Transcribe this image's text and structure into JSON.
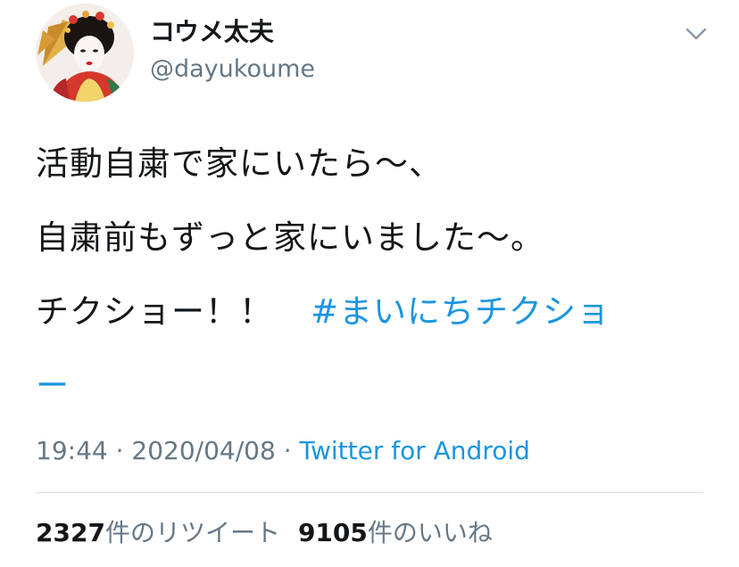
{
  "user": {
    "display_name": "コウメ太夫",
    "handle": "@dayukoume"
  },
  "icons": {
    "avatar": "profile-photo",
    "menu": "chevron-down-icon"
  },
  "tweet": {
    "line1": "活動自粛で家にいたら〜、",
    "line2": "自粛前もずっと家にいました〜。",
    "line3_text": "チクショー！！",
    "hashtag": "#まいにちチクショ",
    "hashtag_wrap": "ー"
  },
  "meta": {
    "time": "19:44",
    "separator1": " · ",
    "date": "2020/04/08",
    "separator2": " · ",
    "source": "Twitter for Android"
  },
  "stats": {
    "retweets_count": "2327",
    "retweets_label": "件のリツイート",
    "likes_count": "9105",
    "likes_label": "件のいいね"
  },
  "colors": {
    "text": "#14171a",
    "secondary": "#657786",
    "link": "#1b95e0",
    "divider": "#d9dee2"
  }
}
